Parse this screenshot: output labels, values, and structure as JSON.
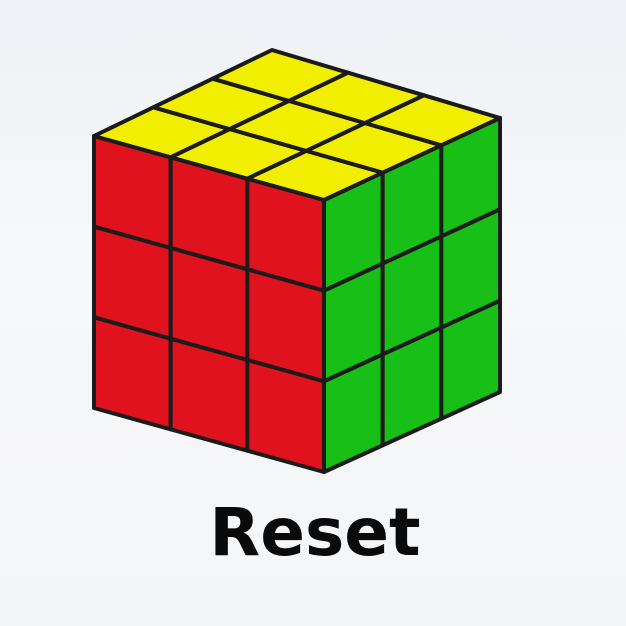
{
  "cube": {
    "size": 3,
    "faces": {
      "top": [
        [
          "yellow",
          "yellow",
          "yellow"
        ],
        [
          "yellow",
          "yellow",
          "yellow"
        ],
        [
          "yellow",
          "yellow",
          "yellow"
        ]
      ],
      "front": [
        [
          "red",
          "red",
          "red"
        ],
        [
          "red",
          "red",
          "red"
        ],
        [
          "red",
          "red",
          "red"
        ]
      ],
      "right": [
        [
          "green",
          "green",
          "green"
        ],
        [
          "green",
          "green",
          "green"
        ],
        [
          "green",
          "green",
          "green"
        ]
      ]
    },
    "colors": {
      "yellow": "#f2ee00",
      "red": "#e0121e",
      "green": "#17bf17",
      "edge": "#1b1b1b"
    }
  },
  "reset_button": {
    "label": "Reset"
  }
}
